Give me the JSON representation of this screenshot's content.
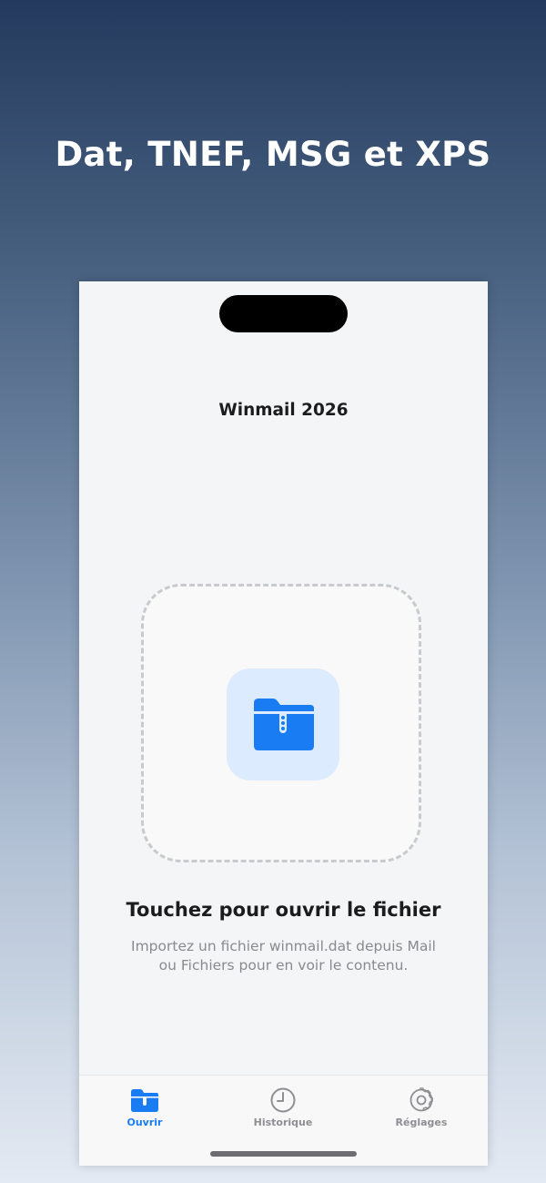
{
  "promo": {
    "headline": "Dat, TNEF, MSG et XPS"
  },
  "app": {
    "title": "Winmail 2026",
    "accent_color": "#1a7cf3"
  },
  "drop_zone": {
    "icon": "folder-icon",
    "title": "Touchez pour ouvrir le fichier",
    "subtitle_lines": [
      "Importez un fichier winmail.dat depuis Mail",
      "ou Fichiers pour en voir le contenu."
    ]
  },
  "tab_bar": {
    "selected": "Ouvrir",
    "tabs": [
      {
        "label": "Ouvrir",
        "icon": "folder-icon"
      },
      {
        "label": "Historique",
        "icon": "clock-icon"
      },
      {
        "label": "Réglages",
        "icon": "gear-icon"
      }
    ]
  }
}
